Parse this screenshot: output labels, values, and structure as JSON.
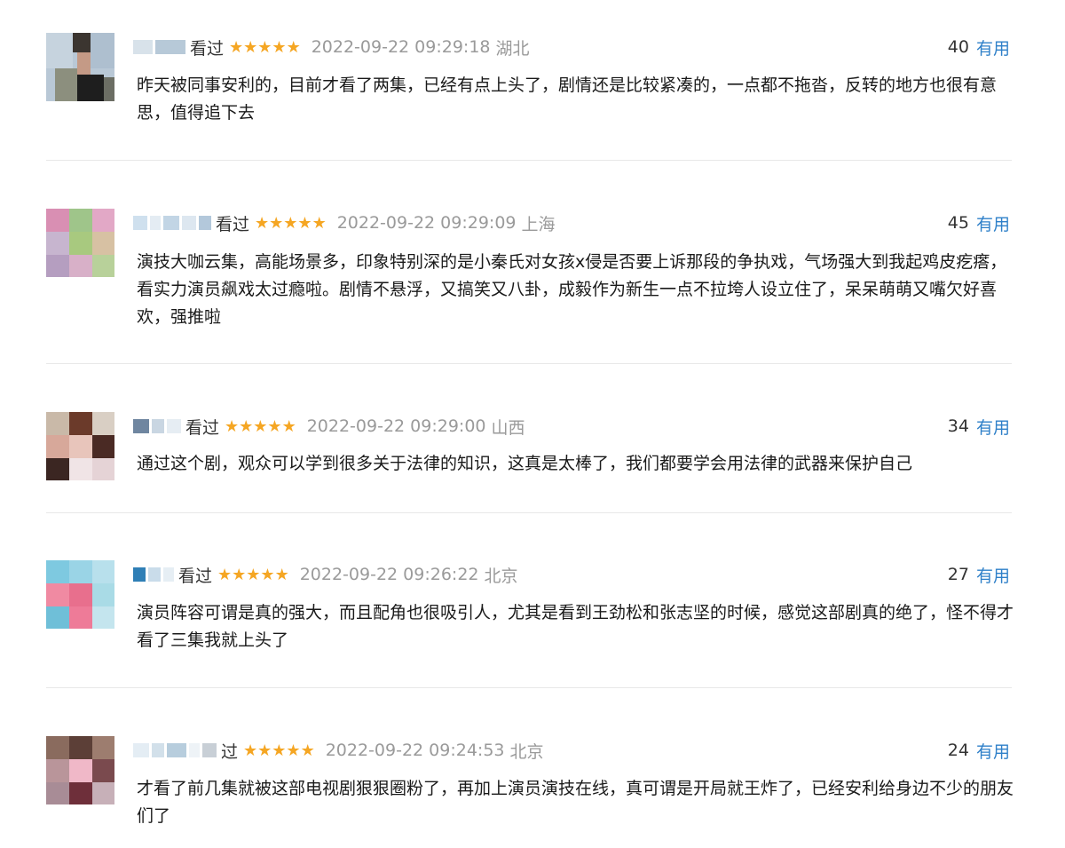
{
  "reviews": [
    {
      "status": "看过",
      "stars": "★★★★★",
      "time": "2022-09-22 09:29:18",
      "location": "湖北",
      "useful_count": "40",
      "useful_label": "有用",
      "content": "昨天被同事安利的，目前才看了两集，已经有点上头了，剧情还是比较紧凑的，一点都不拖沓，反转的地方也很有意思，值得追下去"
    },
    {
      "status": "看过",
      "stars": "★★★★★",
      "time": "2022-09-22 09:29:09",
      "location": "上海",
      "useful_count": "45",
      "useful_label": "有用",
      "content": "演技大咖云集，高能场景多，印象特别深的是小秦氏对女孩x侵是否要上诉那段的争执戏，气场强大到我起鸡皮疙瘩，看实力演员飙戏太过瘾啦。剧情不悬浮，又搞笑又八卦，成毅作为新生一点不拉垮人设立住了，呆呆萌萌又嘴欠好喜欢，强推啦"
    },
    {
      "status": "看过",
      "stars": "★★★★★",
      "time": "2022-09-22 09:29:00",
      "location": "山西",
      "useful_count": "34",
      "useful_label": "有用",
      "content": "通过这个剧，观众可以学到很多关于法律的知识，这真是太棒了，我们都要学会用法律的武器来保护自己"
    },
    {
      "status": "看过",
      "stars": "★★★★★",
      "time": "2022-09-22 09:26:22",
      "location": "北京",
      "useful_count": "27",
      "useful_label": "有用",
      "content": "演员阵容可谓是真的强大，而且配角也很吸引人，尤其是看到王劲松和张志坚的时候，感觉这部剧真的绝了，怪不得才看了三集我就上头了"
    },
    {
      "status": "过",
      "stars": "★★★★★",
      "time": "2022-09-22 09:24:53",
      "location": "北京",
      "useful_count": "24",
      "useful_label": "有用",
      "content": "才看了前几集就被这部电视剧狠狠圈粉了，再加上演员演技在线，真可谓是开局就王炸了，已经安利给身边不少的朋友们了"
    }
  ]
}
